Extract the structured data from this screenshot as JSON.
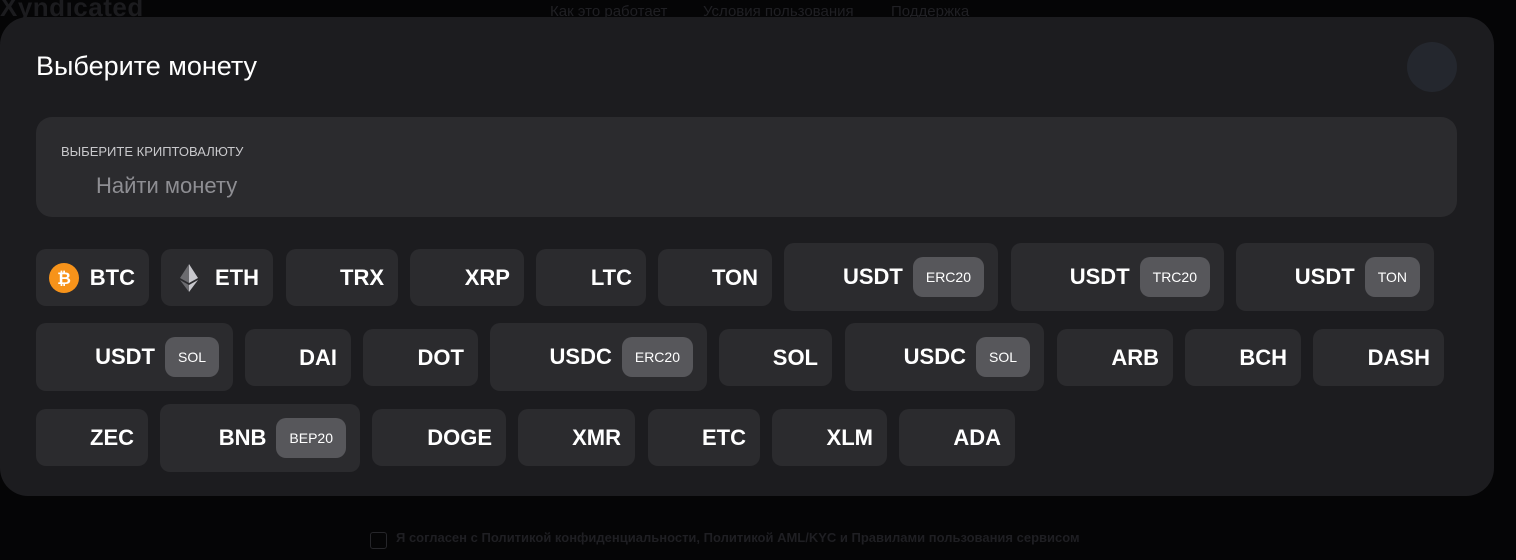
{
  "background": {
    "logo": "Xyndicated",
    "nav": [
      "Как это работает",
      "Условия пользования",
      "Поддержка"
    ],
    "consent": "Я согласен с Политикой конфиденциальности, Политикой AML/KYC и Правилами пользования сервисом"
  },
  "modal": {
    "title": "Выберите монету",
    "search": {
      "label": "ВЫБЕРИТЕ КРИПТОВАЛЮТУ",
      "placeholder": "Найти монету",
      "value": ""
    },
    "coins": [
      {
        "symbol": "BTC",
        "icon": "bitcoin-icon"
      },
      {
        "symbol": "ETH",
        "icon": "ethereum-icon"
      },
      {
        "symbol": "TRX"
      },
      {
        "symbol": "XRP"
      },
      {
        "symbol": "LTC"
      },
      {
        "symbol": "TON"
      },
      {
        "symbol": "USDT",
        "network": "ERC20"
      },
      {
        "symbol": "USDT",
        "network": "TRC20"
      },
      {
        "symbol": "USDT",
        "network": "TON"
      },
      {
        "symbol": "USDT",
        "network": "SOL"
      },
      {
        "symbol": "DAI"
      },
      {
        "symbol": "DOT"
      },
      {
        "symbol": "USDC",
        "network": "ERC20"
      },
      {
        "symbol": "SOL"
      },
      {
        "symbol": "USDC",
        "network": "SOL"
      },
      {
        "symbol": "ARB"
      },
      {
        "symbol": "BCH"
      },
      {
        "symbol": "DASH"
      },
      {
        "symbol": "ZEC"
      },
      {
        "symbol": "BNB",
        "network": "BEP20"
      },
      {
        "symbol": "DOGE"
      },
      {
        "symbol": "XMR"
      },
      {
        "symbol": "ETC"
      },
      {
        "symbol": "XLM"
      },
      {
        "symbol": "ADA"
      }
    ]
  },
  "colors": {
    "page_bg": "#050506",
    "modal_bg": "#1c1c1f",
    "chip_bg": "#2b2b2e",
    "badge_bg": "#57575b",
    "bitcoin": "#f7931a",
    "close_button": "#24272e"
  }
}
